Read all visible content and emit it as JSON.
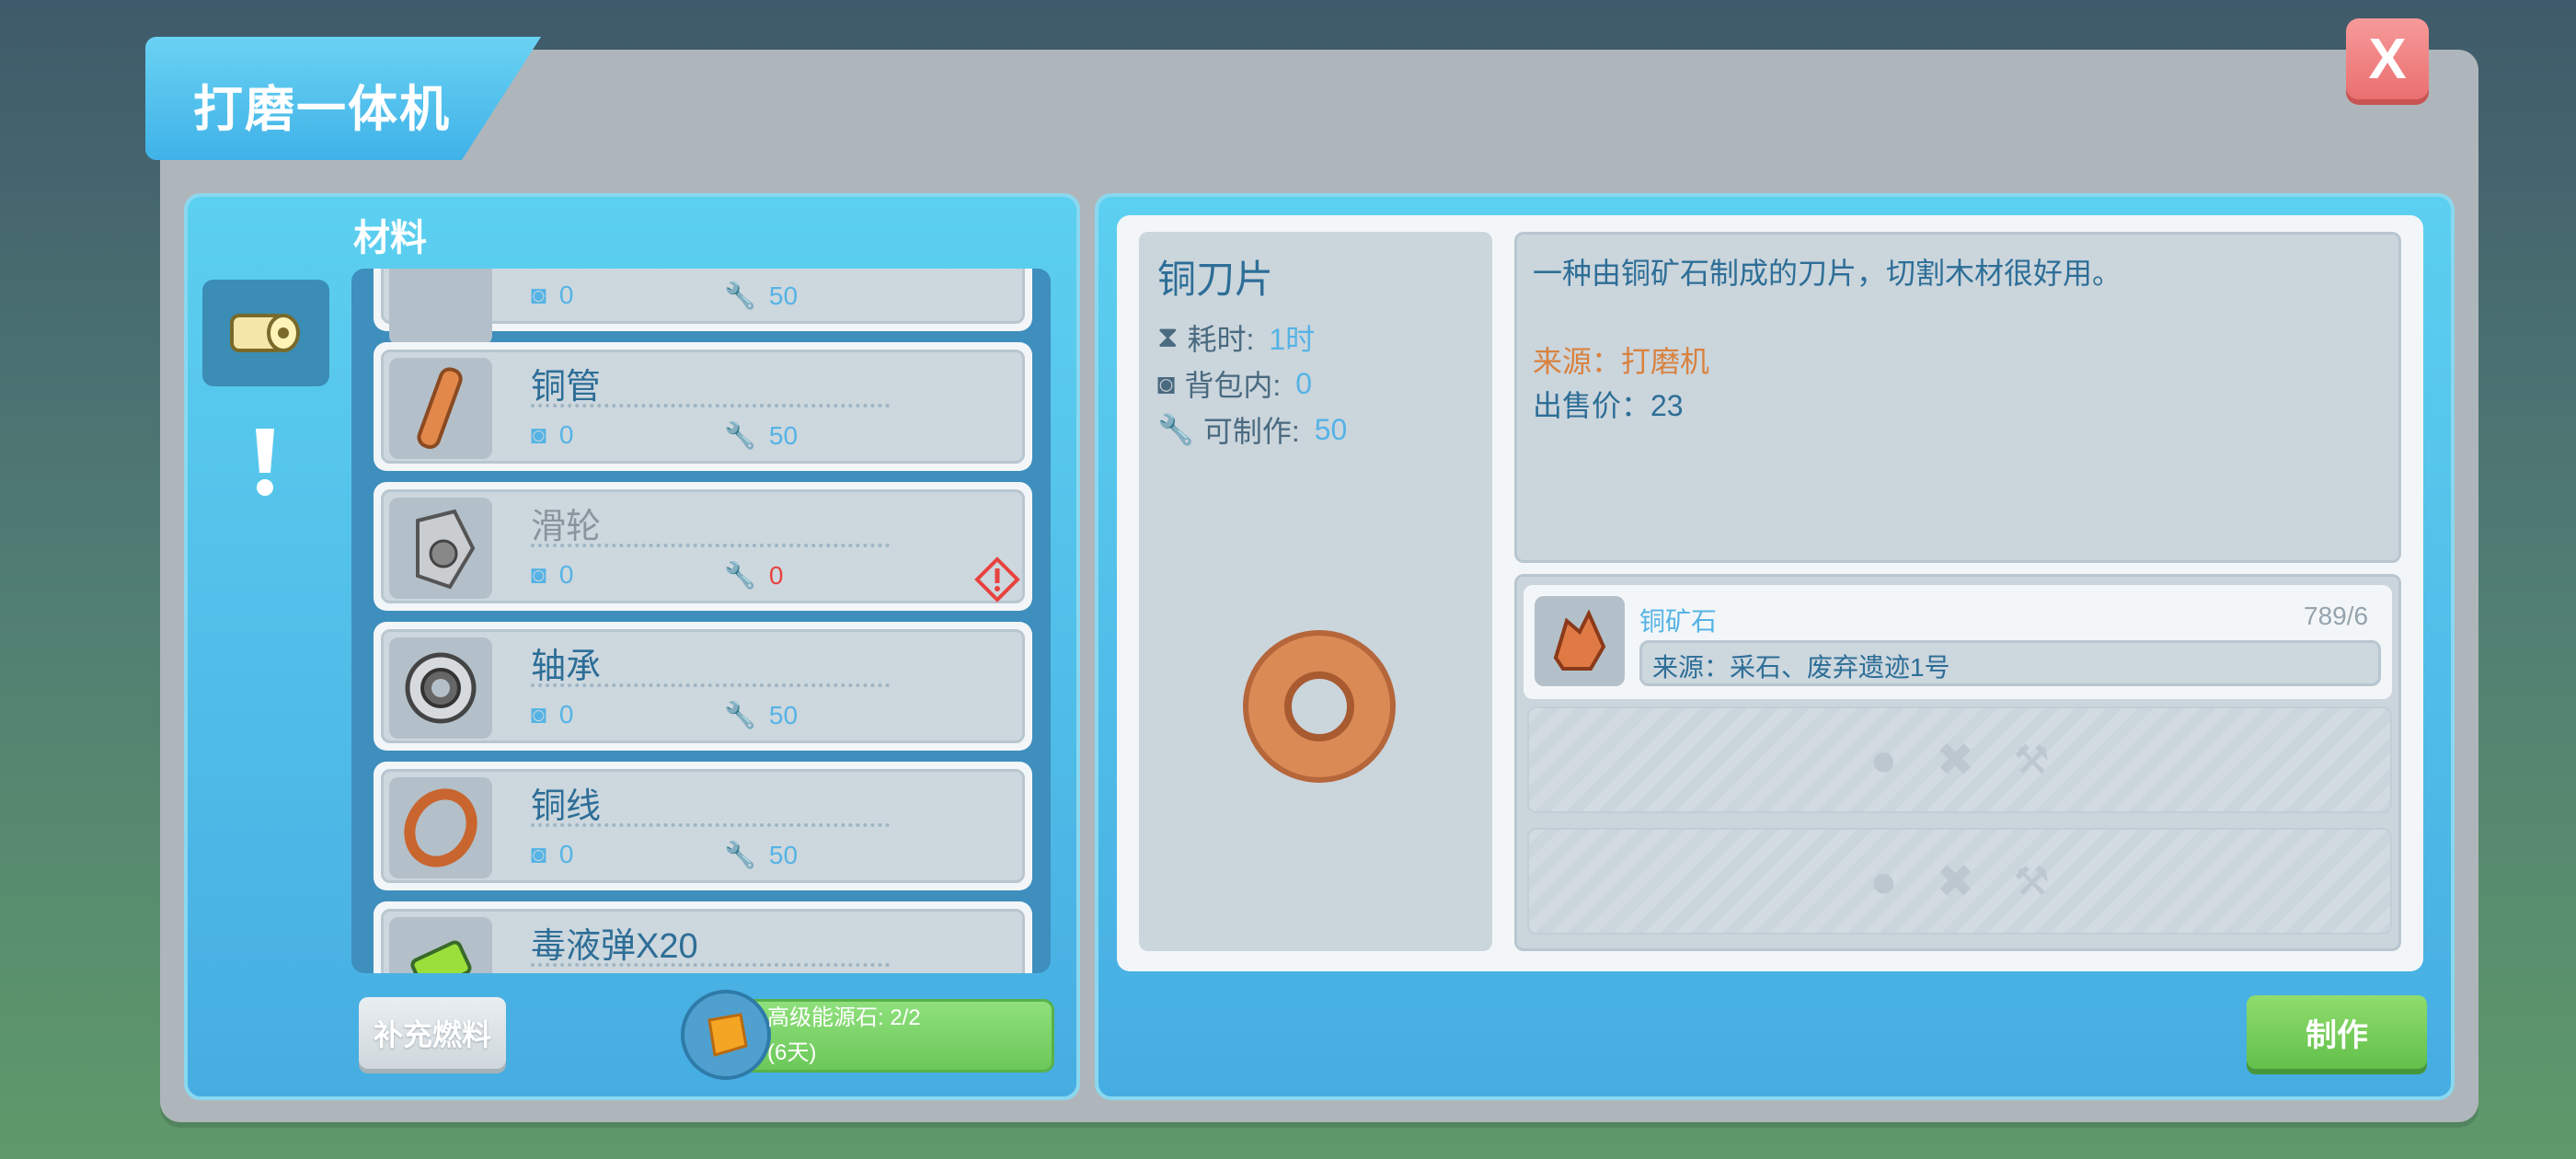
{
  "window": {
    "title": "打磨一体机",
    "close_label": "X"
  },
  "left": {
    "section_label": "材料",
    "tabs": [
      {
        "icon": "material-roll-icon",
        "active": true
      },
      {
        "icon": "exclamation-icon",
        "active": false
      }
    ],
    "items": [
      {
        "name": "",
        "bag": "0",
        "craftable": "50",
        "disabled": false
      },
      {
        "name": "铜管",
        "bag": "0",
        "craftable": "50",
        "disabled": false
      },
      {
        "name": "滑轮",
        "bag": "0",
        "craftable": "0",
        "disabled": true,
        "warning": true
      },
      {
        "name": "轴承",
        "bag": "0",
        "craftable": "50",
        "disabled": false
      },
      {
        "name": "铜线",
        "bag": "0",
        "craftable": "50",
        "disabled": false
      },
      {
        "name": "毒液弹X20",
        "bag": "",
        "craftable": "",
        "disabled": false
      }
    ],
    "refuel_label": "补充燃料",
    "energy": {
      "line1": "高级能源石: 2/2",
      "line2": "(6天)"
    }
  },
  "detail": {
    "name": "铜刀片",
    "time_label": "耗时:",
    "time_value": "1时",
    "bag_label": "背包内:",
    "bag_value": "0",
    "craft_label": "可制作:",
    "craft_value": "50",
    "description": "一种由铜矿石制成的刀片，切割木材很好用。",
    "source": "来源：打磨机",
    "price": "出售价：23"
  },
  "materials": [
    {
      "name": "铜矿石",
      "count": "789/6",
      "source": "来源：采石、废弃遗迹1号"
    }
  ],
  "make_label": "制作",
  "colors": {
    "accent": "#46ade2",
    "ok": "#62c04b",
    "warn": "#e8423f",
    "source": "#d9823f"
  }
}
